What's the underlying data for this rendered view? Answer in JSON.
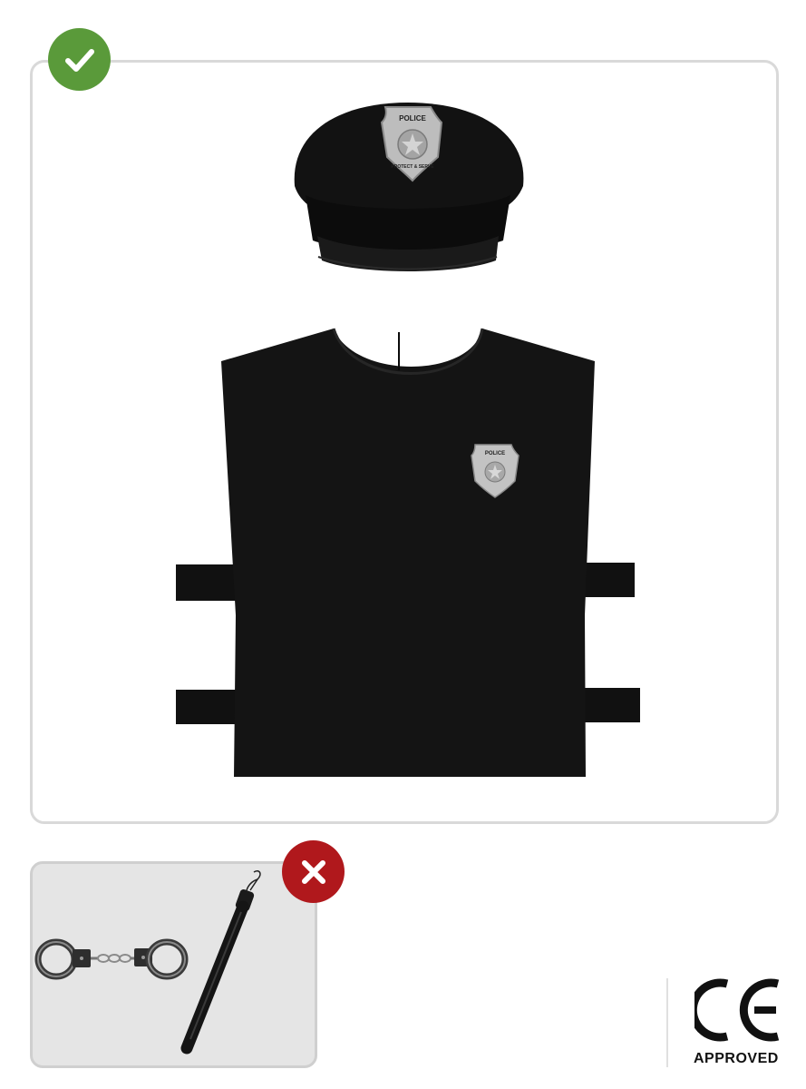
{
  "included": {
    "items": [
      "hat",
      "tabard"
    ],
    "hat_badge_text": "POLICE",
    "hat_badge_subtext": "PROTECT & SERVE",
    "vest_badge_text": "POLICE"
  },
  "excluded": {
    "items": [
      "handcuffs",
      "baton"
    ]
  },
  "certification": {
    "mark": "CE",
    "label": "APPROVED"
  },
  "colors": {
    "included_badge": "#5a9a3a",
    "excluded_badge": "#b0181c",
    "panel_border": "#d9d9d9",
    "excluded_bg": "#e5e5e5",
    "garment": "#111111"
  },
  "icons": {
    "included": "checkmark-icon",
    "excluded": "cross-icon"
  }
}
